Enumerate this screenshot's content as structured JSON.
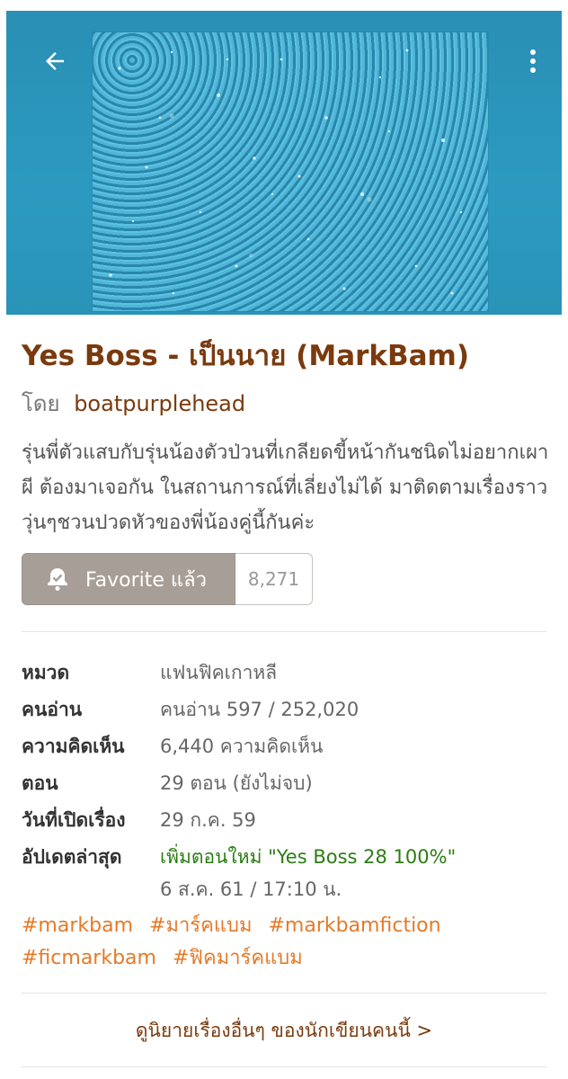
{
  "header": {
    "back_icon": "arrow-left-icon",
    "menu_icon": "more-vertical-icon"
  },
  "novel": {
    "title": "Yes Boss - เป็นนาย (MarkBam)",
    "by_label": "โดย",
    "author": "boatpurplehead",
    "description": "รุ่นพี่ตัวแสบกับรุ่นน้องตัวป่วนที่เกลียดขี้หน้ากันชนิดไม่อยากเผาผี ต้องมาเจอกัน ในสถานการณ์ที่เลี่ยงไม่ได้ มาติดตามเรื่องราววุ่นๆชวนปวดหัวของพี่น้องคู่นี้กันค่ะ"
  },
  "favorite": {
    "label": "Favorite แล้ว",
    "count": "8,271",
    "icon": "bell-check-icon"
  },
  "info": {
    "category_label": "หมวด",
    "category_value": "แฟนฟิคเกาหลี",
    "readers_label": "คนอ่าน",
    "readers_value": "คนอ่าน 597 / 252,020",
    "comments_label": "ความคิดเห็น",
    "comments_value": "6,440 ความคิดเห็น",
    "chapters_label": "ตอน",
    "chapters_value": "29 ตอน (ยังไม่จบ)",
    "opened_label": "วันที่เปิดเรื่อง",
    "opened_value": "29 ก.ค. 59",
    "updated_label": "อัปเดตล่าสุด",
    "updated_value": "เพิ่มตอนใหม่ \"Yes Boss 28 100%\"",
    "updated_time": "6 ส.ค. 61 / 17:10 น."
  },
  "tags": [
    "#markbam",
    "#มาร์คแบม",
    "#markbamfiction",
    "#ficmarkbam",
    "#ฟิคมาร์คแบม"
  ],
  "more_link": "ดูนิยายเรื่องอื่นๆ ของนักเขียนคนนี้ >",
  "colors": {
    "title": "#7a3a0d",
    "tag": "#e47a28",
    "header_bg": "#2c9ac0",
    "favorite_bg": "#a79e97",
    "update_green": "#2a7d12"
  }
}
